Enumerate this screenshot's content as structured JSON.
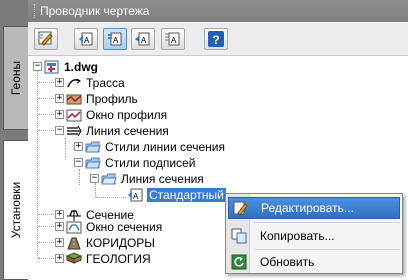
{
  "side_tabs": [
    {
      "label": "Геоны"
    },
    {
      "label": "Установки"
    }
  ],
  "panel": {
    "title": "Проводник чертежа"
  },
  "toolbar": {
    "buttons": [
      {
        "icon": "edit-settings-icon"
      },
      {
        "icon": "style-text-icon"
      },
      {
        "icon": "style-text-active-icon"
      },
      {
        "icon": "style-text-alt-icon"
      },
      {
        "icon": "style-text-table-icon"
      },
      {
        "icon": "help-icon"
      }
    ],
    "help_label": "?"
  },
  "tree": {
    "root": "1.dwg",
    "items": [
      {
        "label": "Трасса"
      },
      {
        "label": "Профиль"
      },
      {
        "label": "Окно профиля"
      },
      {
        "label": "Линия сечения"
      },
      {
        "label": "Стили линии сечения"
      },
      {
        "label": "Стили подписей"
      },
      {
        "label": "Линия сечения"
      },
      {
        "label": "Стандартный"
      },
      {
        "label": "Сечение"
      },
      {
        "label": "Окно сечения"
      },
      {
        "label": "КОРИДОРЫ"
      },
      {
        "label": "ГЕОЛОГИЯ"
      }
    ],
    "expander_plus": "+",
    "expander_minus": "−"
  },
  "context_menu": {
    "items": [
      {
        "label": "Редактировать...",
        "icon": "edit-icon"
      },
      {
        "label": "Копировать...",
        "icon": "copy-icon"
      },
      {
        "label": "Обновить",
        "icon": "refresh-icon"
      }
    ]
  },
  "colors": {
    "selection": "#3a7bd5",
    "menu_hover": "#2f6fc4",
    "folder": "#9fc4ea"
  }
}
